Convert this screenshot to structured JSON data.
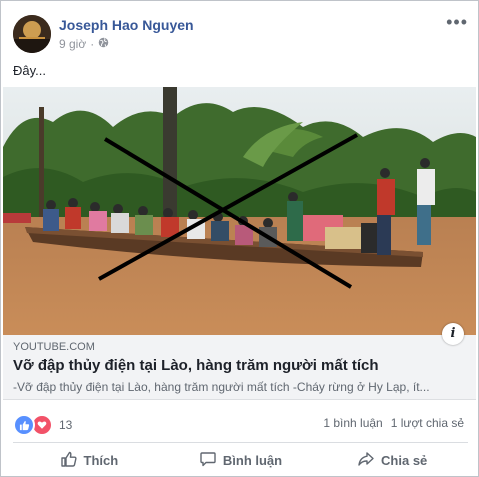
{
  "post": {
    "author": "Joseph Hao Nguyen",
    "time": "9 giờ",
    "privacy_icon": "globe-icon",
    "menu_icon": "more-dots-icon",
    "text": "Đây..."
  },
  "link": {
    "domain": "YOUTUBE.COM",
    "title": "Vỡ đập thủy điện tại Lào, hàng trăm người mất tích",
    "description": "-Vỡ đập thủy điện tại Lào, hàng trăm người mất tích -Cháy rừng ở Hy Lạp, ít...",
    "info_label": "i"
  },
  "stats": {
    "reaction_count": "13",
    "comments": "1 bình luận",
    "shares": "1 lượt chia sẻ"
  },
  "actions": {
    "like": "Thích",
    "comment": "Bình luận",
    "share": "Chia sẻ"
  },
  "colors": {
    "author_link": "#385898",
    "like_reaction": "#5890ff",
    "love_reaction": "#f25268",
    "cross_mark": "#000000"
  }
}
